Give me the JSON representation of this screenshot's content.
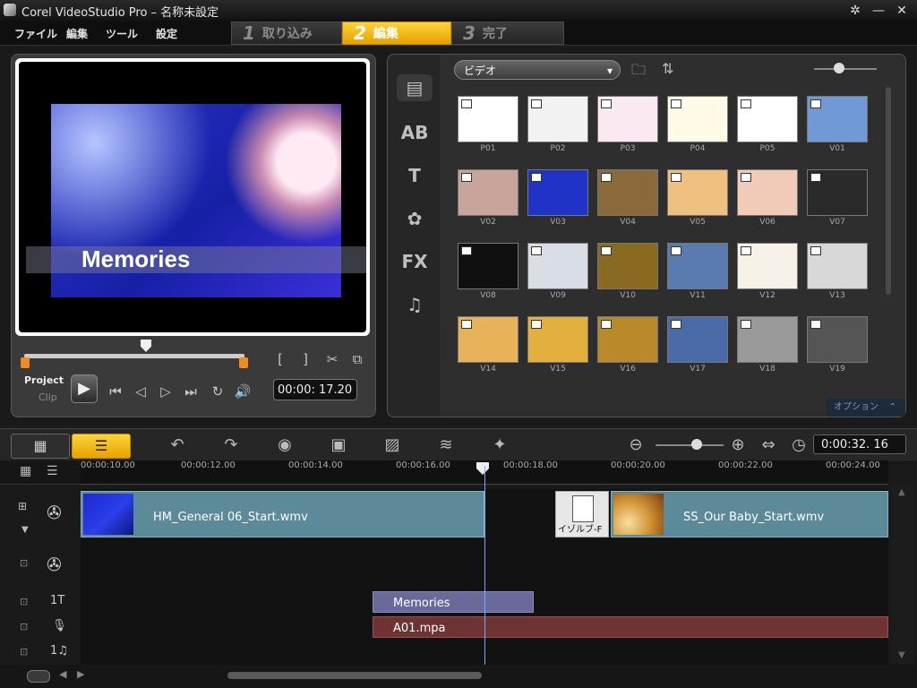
{
  "window": {
    "title": "Corel VideoStudio Pro – 名称未設定"
  },
  "menu": [
    "ファイル",
    "編集",
    "ツール",
    "設定"
  ],
  "steps": [
    {
      "num": "1",
      "label": "取り込み",
      "active": false
    },
    {
      "num": "2",
      "label": "編集",
      "active": true
    },
    {
      "num": "3",
      "label": "完了",
      "active": false
    }
  ],
  "preview": {
    "overlay_text": "Memories",
    "mode_project": "Project",
    "mode_clip": "Clip",
    "timecode": "00:00: 17.20",
    "scrub_position_fraction": 0.53
  },
  "library": {
    "category": "ビデオ",
    "items": [
      {
        "label": "P01",
        "color": "#ffffff",
        "type": "image"
      },
      {
        "label": "P02",
        "color": "#f2f2f2",
        "type": "image"
      },
      {
        "label": "P03",
        "color": "#fbe9f2",
        "type": "image"
      },
      {
        "label": "P04",
        "color": "#fffbe6",
        "type": "image"
      },
      {
        "label": "P05",
        "color": "#ffffff",
        "type": "image"
      },
      {
        "label": "V01",
        "color": "#6f9ad6",
        "type": "video"
      },
      {
        "label": "V02",
        "color": "#c9a49a",
        "type": "video"
      },
      {
        "label": "V03",
        "color": "#1f33c8",
        "type": "video"
      },
      {
        "label": "V04",
        "color": "#8a6a3a",
        "type": "video"
      },
      {
        "label": "V05",
        "color": "#f0c080",
        "type": "video"
      },
      {
        "label": "V06",
        "color": "#f1cbb8",
        "type": "video"
      },
      {
        "label": "V07",
        "color": "#2a2a2a",
        "type": "video"
      },
      {
        "label": "V08",
        "color": "#101010",
        "type": "video"
      },
      {
        "label": "V09",
        "color": "#d9dde6",
        "type": "video"
      },
      {
        "label": "V10",
        "color": "#8a6a20",
        "type": "video"
      },
      {
        "label": "V11",
        "color": "#5a7bb0",
        "type": "video"
      },
      {
        "label": "V12",
        "color": "#f7f2e8",
        "type": "video"
      },
      {
        "label": "V13",
        "color": "#d8d8d8",
        "type": "video"
      },
      {
        "label": "V14",
        "color": "#e8b25a",
        "type": "video"
      },
      {
        "label": "V15",
        "color": "#e3b040",
        "type": "video"
      },
      {
        "label": "V16",
        "color": "#b88a2a",
        "type": "video"
      },
      {
        "label": "V17",
        "color": "#4a6aa8",
        "type": "video"
      },
      {
        "label": "V18",
        "color": "#9a9a9a",
        "type": "video"
      },
      {
        "label": "V19",
        "color": "#555555",
        "type": "video"
      }
    ],
    "option_label": "オプション"
  },
  "timeline": {
    "duration": "0:00:32. 16",
    "ruler": [
      "00:00:10.00",
      "00:00:12.00",
      "00:00:14.00",
      "00:00:16.00",
      "00:00:18.00",
      "00:00:20.00",
      "00:00:22.00",
      "00:00:24.00"
    ],
    "video_clips": [
      {
        "name": "HM_General 06_Start.wmv"
      },
      {
        "name": "イゾルブ-F"
      },
      {
        "name": "SS_Our Baby_Start.wmv"
      }
    ],
    "title_clip": "Memories",
    "audio_clip": "A01.mpa",
    "track_labels": {
      "title": "1T",
      "music": "1♫"
    }
  }
}
